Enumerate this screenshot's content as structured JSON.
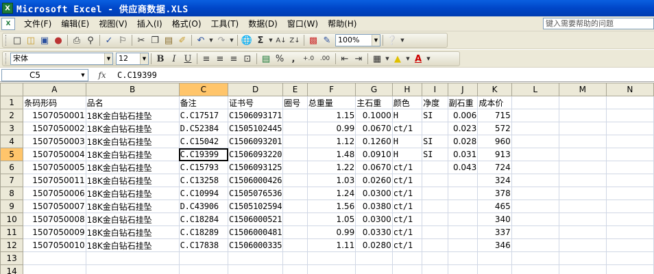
{
  "window": {
    "title": "Microsoft Excel - 供应商数据.XLS",
    "app_icon": "X"
  },
  "menu": {
    "items": [
      "文件(F)",
      "编辑(E)",
      "视图(V)",
      "插入(I)",
      "格式(O)",
      "工具(T)",
      "数据(D)",
      "窗口(W)",
      "帮助(H)"
    ],
    "help_placeholder": "键入需要帮助的问题"
  },
  "standard_toolbar": {
    "zoom": "100%"
  },
  "format_toolbar": {
    "font": "宋体",
    "size": "12",
    "bold": "B",
    "italic": "I",
    "underline": "U",
    "percent": "%",
    "comma": ",",
    "inc_decimal": "+.0",
    "dec_decimal": ".00"
  },
  "formula_bar": {
    "name_box": "C5",
    "fx": "fx",
    "value": "C.C19399"
  },
  "grid": {
    "columns": [
      "A",
      "B",
      "C",
      "D",
      "E",
      "F",
      "G",
      "H",
      "I",
      "J",
      "K",
      "L",
      "M",
      "N"
    ],
    "selected_column": "C",
    "selected_row": "5",
    "rows": [
      {
        "n": "1",
        "cells": [
          "条码形码",
          "品名",
          "备注",
          "证书号",
          "圈号",
          "总重量",
          "主石重",
          "颜色",
          "净度",
          "副石重",
          "成本价",
          "",
          "",
          ""
        ]
      },
      {
        "n": "2",
        "cells": [
          "1507050001",
          "18K金白钻石挂坠",
          "C.C17517",
          "C1506093171",
          "",
          "1.15",
          "0.1000",
          "H",
          "SI",
          "0.006",
          "715",
          "",
          "",
          ""
        ]
      },
      {
        "n": "3",
        "cells": [
          "1507050002",
          "18K金白钻石挂坠",
          "D.C52384",
          "C1505102445",
          "",
          "0.99",
          "0.0670",
          "ct/1",
          "",
          "0.023",
          "572",
          "",
          "",
          ""
        ]
      },
      {
        "n": "4",
        "cells": [
          "1507050003",
          "18K金白钻石挂坠",
          "C.C15042",
          "C1506093201",
          "",
          "1.12",
          "0.1260",
          "H",
          "SI",
          "0.028",
          "960",
          "",
          "",
          ""
        ]
      },
      {
        "n": "5",
        "cells": [
          "1507050004",
          "18K金白钻石挂坠",
          "C.C19399",
          "C1506093220",
          "",
          "1.48",
          "0.0910",
          "H",
          "SI",
          "0.031",
          "913",
          "",
          "",
          ""
        ]
      },
      {
        "n": "6",
        "cells": [
          "1507050005",
          "18K金白钻石挂坠",
          "C.C15793",
          "C1506093125",
          "",
          "1.22",
          "0.0670",
          "ct/1",
          "",
          "0.043",
          "724",
          "",
          "",
          ""
        ]
      },
      {
        "n": "7",
        "cells": [
          "1507050011",
          "18K金白钻石挂坠",
          "C.C13258",
          "C1506000426",
          "",
          "1.03",
          "0.0260",
          "ct/1",
          "",
          "",
          "324",
          "",
          "",
          ""
        ]
      },
      {
        "n": "8",
        "cells": [
          "1507050006",
          "18K金白钻石挂坠",
          "C.C10994",
          "C1505076536",
          "",
          "1.24",
          "0.0300",
          "ct/1",
          "",
          "",
          "378",
          "",
          "",
          ""
        ]
      },
      {
        "n": "9",
        "cells": [
          "1507050007",
          "18K金白钻石挂坠",
          "D.C43906",
          "C1505102594",
          "",
          "1.56",
          "0.0380",
          "ct/1",
          "",
          "",
          "465",
          "",
          "",
          ""
        ]
      },
      {
        "n": "10",
        "cells": [
          "1507050008",
          "18K金白钻石挂坠",
          "C.C18284",
          "C1506000521",
          "",
          "1.05",
          "0.0300",
          "ct/1",
          "",
          "",
          "340",
          "",
          "",
          ""
        ]
      },
      {
        "n": "11",
        "cells": [
          "1507050009",
          "18K金白钻石挂坠",
          "C.C18289",
          "C1506000481",
          "",
          "0.99",
          "0.0330",
          "ct/1",
          "",
          "",
          "337",
          "",
          "",
          ""
        ]
      },
      {
        "n": "12",
        "cells": [
          "1507050010",
          "18K金白钻石挂坠",
          "C.C17838",
          "C1506000335",
          "",
          "1.11",
          "0.0280",
          "ct/1",
          "",
          "",
          "346",
          "",
          "",
          ""
        ]
      },
      {
        "n": "13",
        "cells": [
          "",
          "",
          "",
          "",
          "",
          "",
          "",
          "",
          "",
          "",
          "",
          "",
          "",
          ""
        ]
      },
      {
        "n": "14",
        "cells": [
          "",
          "",
          "",
          "",
          "",
          "",
          "",
          "",
          "",
          "",
          "",
          "",
          "",
          ""
        ]
      }
    ]
  }
}
